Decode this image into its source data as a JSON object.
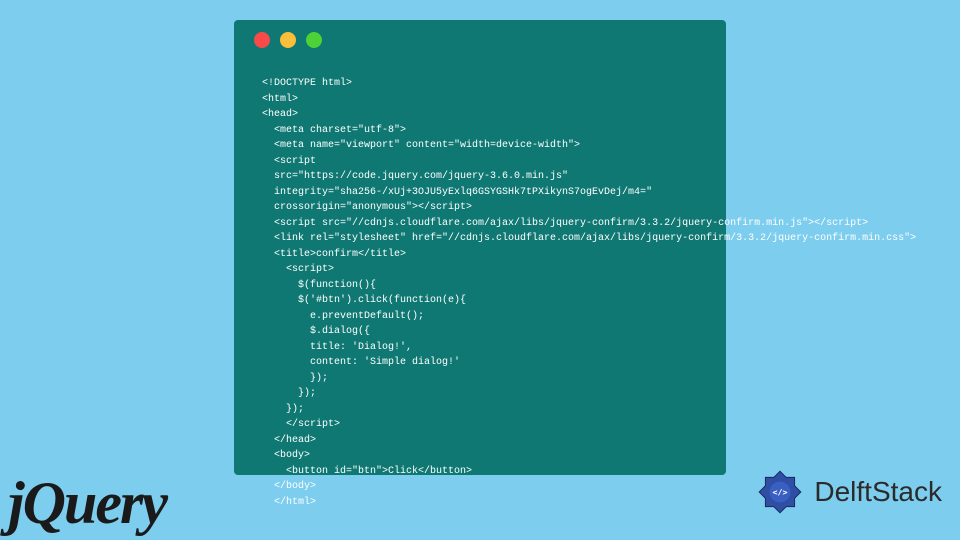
{
  "code": {
    "lines": [
      "<!DOCTYPE html>",
      "<html>",
      "<head>",
      "  <meta charset=\"utf-8\">",
      "  <meta name=\"viewport\" content=\"width=device-width\">",
      "  <script",
      "  src=\"https://code.jquery.com/jquery-3.6.0.min.js\"",
      "  integrity=\"sha256-/xUj+3OJU5yExlq6GSYGSHk7tPXikynS7ogEvDej/m4=\"",
      "  crossorigin=\"anonymous\"></script>",
      "  <script src=\"//cdnjs.cloudflare.com/ajax/libs/jquery-confirm/3.3.2/jquery-confirm.min.js\"></script>",
      "  <link rel=\"stylesheet\" href=\"//cdnjs.cloudflare.com/ajax/libs/jquery-confirm/3.3.2/jquery-confirm.min.css\">",
      "  <title>confirm</title>",
      "    <script>",
      "      $(function(){",
      "      $('#btn').click(function(e){",
      "        e.preventDefault();",
      "        $.dialog({",
      "        title: 'Dialog!',",
      "        content: 'Simple dialog!'",
      "        });",
      "      });",
      "    });",
      "    </script>",
      "  </head>",
      "",
      "  <body>",
      "    <button id=\"btn\">Click</button>",
      "  </body>",
      "  </html>"
    ]
  },
  "logos": {
    "jquery": "jQuery",
    "delftstack": "DelftStack"
  }
}
